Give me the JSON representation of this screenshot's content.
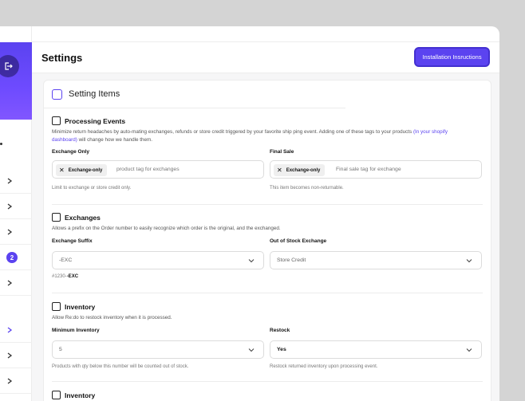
{
  "header": {
    "title": "Settings",
    "install_button": "Installation Insructions"
  },
  "sidebar": {
    "badge_count": "2"
  },
  "card": {
    "title": "Setting Items"
  },
  "processing": {
    "title": "Processing Events",
    "desc_before": "Minimize return headaches by auto-mating exchanges, refunds or store credit triggered by your favorite ship ping event. Adding one of these tags to your products ",
    "desc_link": "(In your shopify dashboard)",
    "desc_after": " will change how we handle them.",
    "exchange_only": {
      "label": "Exchange Only",
      "tag": "Exchange-only",
      "placeholder": "product tag for exchanges",
      "help": "Limit to exchange or store credit only."
    },
    "final_sale": {
      "label": "Final Sale",
      "tag": "Exchange-only",
      "placeholder": "Final sale tag for exchange",
      "help": "This item becomes non-returnable."
    }
  },
  "exchanges": {
    "title": "Exchanges",
    "desc": "Allows a prefix on the Order number to easily recognize which order is the original, and the exchanged.",
    "suffix": {
      "label": "Exchange Suffix",
      "value": "-EXC",
      "example_prefix": "#1230-",
      "example_value": "-EXC"
    },
    "out_of_stock": {
      "label": "Out of Stock Exchange",
      "value": "Store Credit"
    }
  },
  "inventory": {
    "title": "Inventory",
    "desc": "Allow Re:do to restock inventory when it is processed.",
    "minimum": {
      "label": "Minimum Inventory",
      "value": "5",
      "help": "Products with qty below this number will be counted out of stock."
    },
    "restock": {
      "label": "Restock",
      "value": "Yes",
      "help": "Restock returned inventory upon processing event."
    }
  },
  "next_section": {
    "title": "Inventory"
  },
  "colors": {
    "accent": "#5b43f0",
    "background": "#d4d4d4"
  }
}
